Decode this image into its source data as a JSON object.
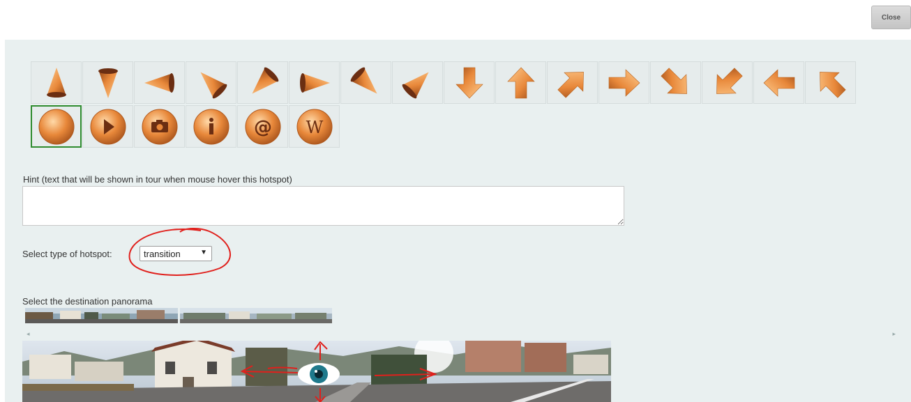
{
  "header": {
    "close_label": "Close"
  },
  "icons": {
    "row1": [
      "cone-up-icon",
      "cone-down-icon",
      "cone-left-icon",
      "cone-up-left-icon",
      "cone-down-left-icon",
      "cone-right-icon",
      "cone-down-right-icon",
      "cone-up-right-icon",
      "arrow-down-icon",
      "arrow-up-icon",
      "arrow-up-right-icon",
      "arrow-right-icon",
      "arrow-down-right-icon",
      "arrow-down-left-icon",
      "arrow-left-icon",
      "arrow-up-left-icon"
    ],
    "row2": [
      "circle-icon",
      "play-icon",
      "camera-icon",
      "info-icon",
      "at-icon",
      "wikipedia-icon"
    ],
    "selected_index": 0,
    "accent_color": "#e8883a"
  },
  "hint": {
    "label": "Hint (text that will be shown in tour when mouse hover this hotspot)",
    "value": ""
  },
  "hotspot_type": {
    "label": "Select type of hotspot:",
    "selected": "transition",
    "arrow": "▼"
  },
  "destination": {
    "label": "Select the destination panorama",
    "thumbnail_count": 2
  },
  "scrollbar": {
    "left_arrow": "◂",
    "right_arrow": "▸"
  },
  "colors": {
    "panel_bg": "#e9f0f0",
    "selected_border": "#2e8b2e",
    "annotation": "#e0201c"
  }
}
